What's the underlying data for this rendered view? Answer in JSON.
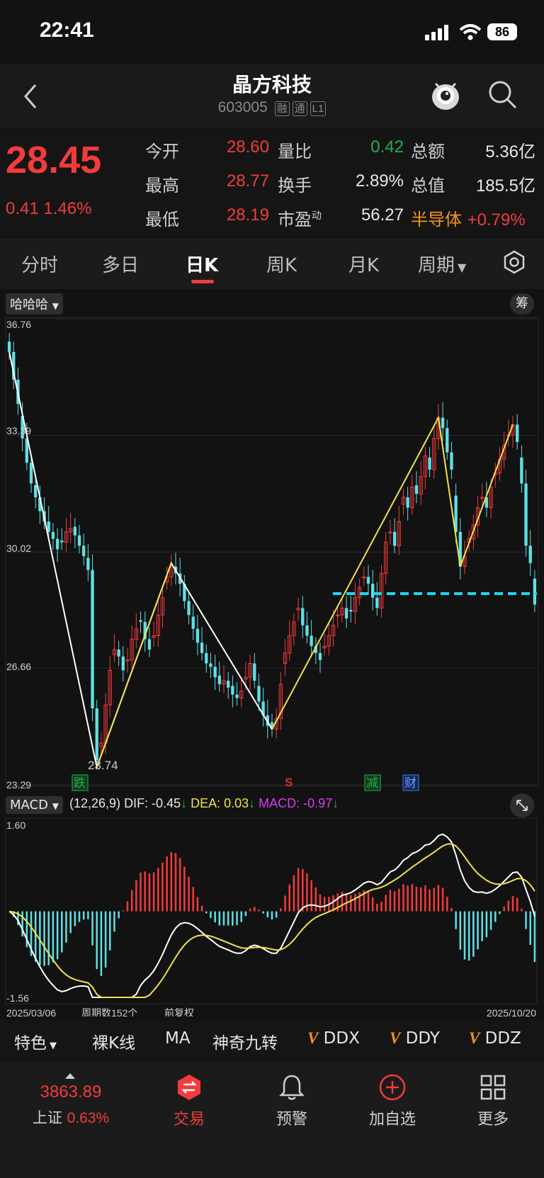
{
  "status": {
    "time": "22:41",
    "battery": "86"
  },
  "header": {
    "title": "晶方科技",
    "code": "603005",
    "tags": [
      "融",
      "通",
      "L1"
    ]
  },
  "quote": {
    "price": "28.45",
    "change": "0.41",
    "change_pct": "1.46%",
    "labels": {
      "open": "今开",
      "high": "最高",
      "low": "最低",
      "vol_ratio": "量比",
      "turnover": "换手",
      "pe": "市盈",
      "pe_sup": "动",
      "amount": "总额",
      "mcap": "总值"
    },
    "values": {
      "open": "28.60",
      "high": "28.77",
      "low": "28.19",
      "vol_ratio": "0.42",
      "turnover": "2.89%",
      "pe": "56.27",
      "amount": "5.36亿",
      "mcap": "185.5亿"
    },
    "sector": {
      "name": "半导体",
      "change": "+0.79%"
    }
  },
  "tabs": {
    "items": [
      "分时",
      "多日",
      "日K",
      "周K",
      "月K",
      "周期"
    ],
    "active": "日K"
  },
  "chart": {
    "indicator_dropdown": "哈哈哈",
    "chip_button": "筹",
    "y_labels": [
      "36.76",
      "33.39",
      "30.02",
      "26.66",
      "23.29"
    ],
    "low_label": "23.74",
    "markers": [
      "跌",
      "S",
      "减",
      "财"
    ],
    "macd": {
      "dropdown": "MACD",
      "params": "(12,26,9)",
      "dif": "DIF: -0.45",
      "dea": "DEA: 0.03",
      "macd": "MACD: -0.97",
      "arrow": "↓",
      "y_top": "1.60",
      "y_bottom": "-1.56"
    },
    "footer": {
      "start": "2025/03/06",
      "count": "周期数152个",
      "adjust": "前复权",
      "end": "2025/10/20"
    },
    "colors": {
      "up": "#f43b3b",
      "down": "#5fe0e6",
      "dashed": "#22d3ee",
      "dif": "#ffffff",
      "dea": "#f1e24a",
      "macd": "#d63df0"
    }
  },
  "chart_data": {
    "type": "candlestick",
    "x_range": [
      "2025/03/06",
      "2025/10/20"
    ],
    "periods": 152,
    "ylim": [
      23.29,
      36.76
    ],
    "y_ticks": [
      36.76,
      33.39,
      30.02,
      26.66,
      23.29
    ],
    "low_marker": 23.74,
    "close_series": [
      35.8,
      35.0,
      34.3,
      33.3,
      32.6,
      32.0,
      31.6,
      31.2,
      30.9,
      30.6,
      30.4,
      30.1,
      30.3,
      30.6,
      30.7,
      30.5,
      30.2,
      29.9,
      29.5,
      25.5,
      24.0,
      24.5,
      25.6,
      26.6,
      27.2,
      27.0,
      26.6,
      26.9,
      27.5,
      27.8,
      28.0,
      27.5,
      27.2,
      27.6,
      28.2,
      28.7,
      29.3,
      29.6,
      29.4,
      29.1,
      28.6,
      28.2,
      27.8,
      27.4,
      27.1,
      26.8,
      26.7,
      26.4,
      26.2,
      26.3,
      26.1,
      25.9,
      25.8,
      26.0,
      26.4,
      26.8,
      26.3,
      25.7,
      25.3,
      25.0,
      24.9,
      25.2,
      26.2,
      27.1,
      27.6,
      28.0,
      28.4,
      27.9,
      27.6,
      27.3,
      27.1,
      26.9,
      27.3,
      27.6,
      27.9,
      28.2,
      28.4,
      28.1,
      28.3,
      28.7,
      29.0,
      29.3,
      29.1,
      28.7,
      28.4,
      29.4,
      30.3,
      30.6,
      30.2,
      30.9,
      31.6,
      31.3,
      31.9,
      31.7,
      32.2,
      32.8,
      32.4,
      33.3,
      33.9,
      33.6,
      32.9,
      32.4,
      30.6,
      29.6,
      29.9,
      30.4,
      30.8,
      31.3,
      31.6,
      31.3,
      31.9,
      32.3,
      32.7,
      33.1,
      33.4,
      33.7,
      33.2,
      32.0,
      30.2,
      29.7,
      28.5
    ]
  },
  "features": {
    "dropdown": "特色",
    "items": [
      "裸K线",
      "MA",
      "神奇九转",
      "DDX",
      "DDY",
      "DDZ"
    ],
    "v": "V"
  },
  "bottom_nav": {
    "index": {
      "value": "3863.89",
      "name": "上证",
      "change": "0.63%"
    },
    "items": [
      "交易",
      "预警",
      "加自选",
      "更多"
    ]
  }
}
